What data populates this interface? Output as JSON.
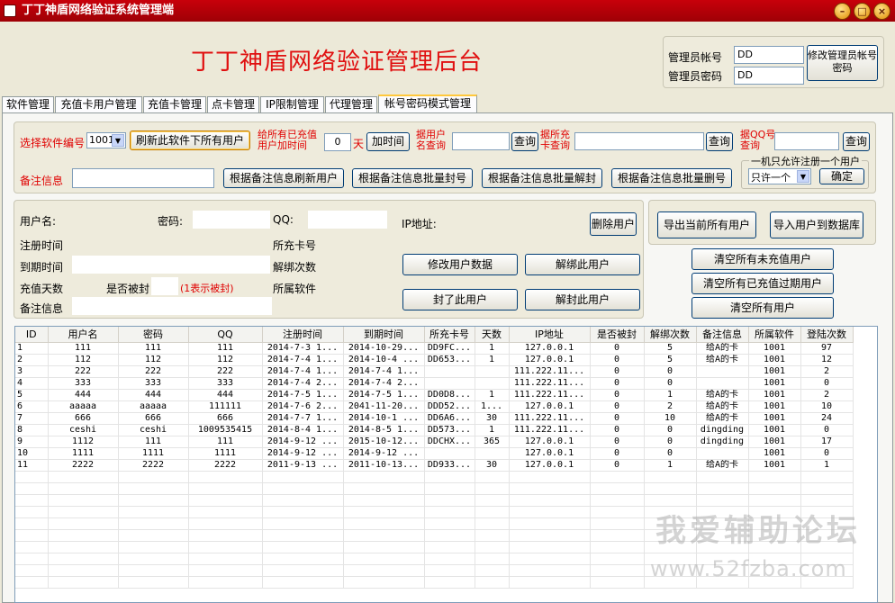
{
  "window": {
    "title": "丁丁神盾网络验证系统管理端",
    "min": "–",
    "max": "□",
    "close": "×"
  },
  "header": {
    "title": "丁丁神盾网络验证管理后台"
  },
  "admin": {
    "account_label": "管理员帐号",
    "password_label": "管理员密码",
    "account_value": "DD",
    "password_value": "DD",
    "modify_button": "修改管理员帐号密码"
  },
  "tabs": [
    "软件管理",
    "充值卡用户管理",
    "充值卡管理",
    "点卡管理",
    "IP限制管理",
    "代理管理",
    "帐号密码模式管理"
  ],
  "toolbar": {
    "software_no_label": "选择软件编号",
    "software_no_value": "1001",
    "refresh_all_button": "刷新此软件下所有用户",
    "add_time_label_1": "给所有已充值",
    "add_time_label_2": "用户加时间",
    "add_time_value": "0",
    "day_unit": "天",
    "add_time_button": "加时间",
    "by_user_label_1": "据用户",
    "by_user_label_2": "名查询",
    "query_button": "查询",
    "by_card_label_1": "据所充",
    "by_card_label_2": "卡查询",
    "by_qq_label_1": "据QQ号",
    "by_qq_label_2": "查询",
    "remark_label": "备注信息",
    "refresh_by_remark": "根据备注信息刷新用户",
    "ban_by_remark": "根据备注信息批量封号",
    "unban_by_remark": "根据备注信息批量解封",
    "delete_by_remark": "根据备注信息批量删号",
    "one_machine_title": "一机只允许注册一个用户",
    "one_machine_value": "只许一个",
    "confirm_button": "确定"
  },
  "detail": {
    "username_label": "用户名:",
    "password_label": "密码:",
    "qq_label": "QQ:",
    "ip_label": "IP地址:",
    "reg_time_label": "注册时间",
    "card_label": "所充卡号",
    "expire_label": "到期时间",
    "unbind_label": "解绑次数",
    "days_label": "充值天数",
    "banned_label": "是否被封",
    "banned_hint": "(1表示被封)",
    "software_label": "所属软件",
    "remark_label": "备注信息",
    "delete_user_button": "删除用户",
    "modify_user_button": "修改用户数据",
    "unbind_user_button": "解绑此用户",
    "ban_user_button": "封了此用户",
    "unban_user_button": "解封此用户",
    "export_button": "导出当前所有用户",
    "import_button": "导入用户到数据库",
    "clear_unpaid_button": "清空所有未充值用户",
    "clear_expired_button": "清空所有已充值过期用户",
    "clear_all_button": "清空所有用户"
  },
  "table": {
    "columns": [
      "ID",
      "用户名",
      "密码",
      "QQ",
      "注册时间",
      "到期时间",
      "所充卡号",
      "天数",
      "IP地址",
      "是否被封",
      "解绑次数",
      "备注信息",
      "所属软件",
      "登陆次数"
    ],
    "rows": [
      [
        "1",
        "111",
        "111",
        "111",
        "2014-7-3 1...",
        "2014-10-29...",
        "DD9FC...",
        "1",
        "127.0.0.1",
        "0",
        "5",
        "给A的卡",
        "1001",
        "97"
      ],
      [
        "2",
        "112",
        "112",
        "112",
        "2014-7-4 1...",
        "2014-10-4 ...",
        "DD653...",
        "1",
        "127.0.0.1",
        "0",
        "5",
        "给A的卡",
        "1001",
        "12"
      ],
      [
        "3",
        "222",
        "222",
        "222",
        "2014-7-4 1...",
        "2014-7-4 1...",
        "",
        "",
        "111.222.11...",
        "0",
        "0",
        "",
        "1001",
        "2"
      ],
      [
        "4",
        "333",
        "333",
        "333",
        "2014-7-4 2...",
        "2014-7-4 2...",
        "",
        "",
        "111.222.11...",
        "0",
        "0",
        "",
        "1001",
        "0"
      ],
      [
        "5",
        "444",
        "444",
        "444",
        "2014-7-5 1...",
        "2014-7-5 1...",
        "DD0D8...",
        "1",
        "111.222.11...",
        "0",
        "1",
        "给A的卡",
        "1001",
        "2"
      ],
      [
        "6",
        "aaaaa",
        "aaaaa",
        "111111",
        "2014-7-6 2...",
        "2041-11-20...",
        "DDD52...",
        "1...",
        "127.0.0.1",
        "0",
        "2",
        "给A的卡",
        "1001",
        "10"
      ],
      [
        "7",
        "666",
        "666",
        "666",
        "2014-7-7 1...",
        "2014-10-1 ...",
        "DD6A6...",
        "30",
        "111.222.11...",
        "0",
        "10",
        "给A的卡",
        "1001",
        "24"
      ],
      [
        "8",
        "ceshi",
        "ceshi",
        "1009535415",
        "2014-8-4 1...",
        "2014-8-5 1...",
        "DD573...",
        "1",
        "111.222.11...",
        "0",
        "0",
        "dingding",
        "1001",
        "0"
      ],
      [
        "9",
        "1112",
        "111",
        "111",
        "2014-9-12 ...",
        "2015-10-12...",
        "DDCHX...",
        "365",
        "127.0.0.1",
        "0",
        "0",
        "dingding",
        "1001",
        "17"
      ],
      [
        "10",
        "1111",
        "1111",
        "1111",
        "2014-9-12 ...",
        "2014-9-12 ...",
        "",
        "",
        "127.0.0.1",
        "0",
        "0",
        "",
        "1001",
        "0"
      ],
      [
        "11",
        "2222",
        "2222",
        "2222",
        "2011-9-13 ...",
        "2011-10-13...",
        "DD933...",
        "30",
        "127.0.0.1",
        "0",
        "1",
        "给A的卡",
        "1001",
        "1"
      ]
    ]
  },
  "watermark": {
    "line1": "我爱辅助论坛",
    "line2": "www.52fzba.com"
  }
}
